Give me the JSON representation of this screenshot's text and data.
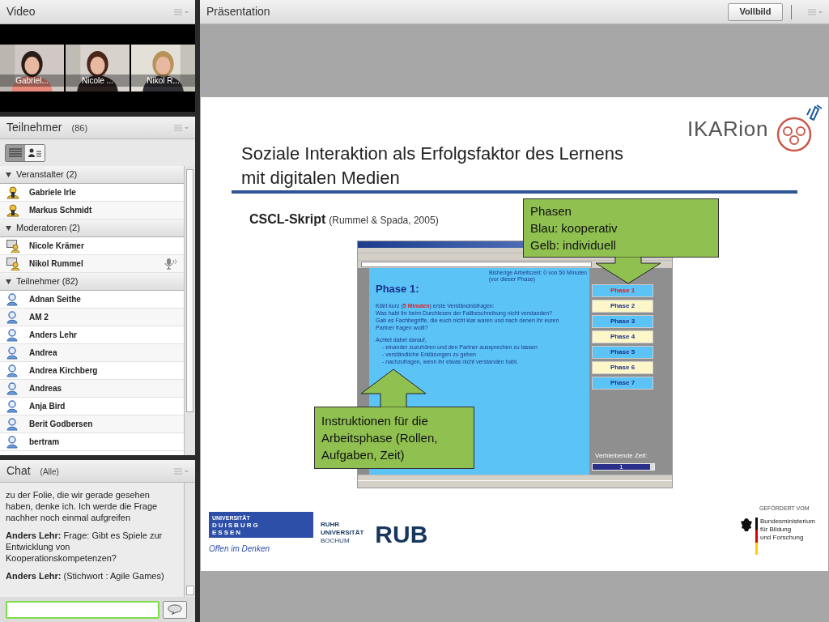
{
  "video": {
    "title": "Video",
    "tiles": [
      {
        "name": "Gabriel..."
      },
      {
        "name": "Nicole ..."
      },
      {
        "name": "Nikol R..."
      }
    ]
  },
  "attendees": {
    "title": "Teilnehmer",
    "count": "(86)",
    "views": [
      {
        "kind": "list",
        "selected": true
      },
      {
        "kind": "card",
        "selected": false
      }
    ],
    "groups": [
      {
        "label": "Veranstalter (2)",
        "expanded": true,
        "members": [
          {
            "name": "Gabriele Irle",
            "kind": "host",
            "speaking": false
          },
          {
            "name": "Markus Schmidt",
            "kind": "host",
            "speaking": false
          }
        ]
      },
      {
        "label": "Moderatoren (2)",
        "expanded": true,
        "members": [
          {
            "name": "Nicole Krämer",
            "kind": "presenter",
            "speaking": false
          },
          {
            "name": "Nikol Rummel",
            "kind": "presenter",
            "speaking": true
          }
        ]
      },
      {
        "label": "Teilnehmer (82)",
        "expanded": true,
        "members": [
          {
            "name": "Adnan Seithe",
            "kind": "participant",
            "speaking": false
          },
          {
            "name": "AM 2",
            "kind": "participant",
            "speaking": false
          },
          {
            "name": "Anders Lehr",
            "kind": "participant",
            "speaking": false
          },
          {
            "name": "Andrea",
            "kind": "participant",
            "speaking": false
          },
          {
            "name": "Andrea Kirchberg",
            "kind": "participant",
            "speaking": false
          },
          {
            "name": "Andreas",
            "kind": "participant",
            "speaking": false
          },
          {
            "name": "Anja Bird",
            "kind": "participant",
            "speaking": false
          },
          {
            "name": "Berit Godbersen",
            "kind": "participant",
            "speaking": false
          },
          {
            "name": "bertram",
            "kind": "participant",
            "speaking": false
          }
        ]
      }
    ]
  },
  "chat": {
    "title": "Chat",
    "scope": "(Alle)",
    "messages": [
      {
        "text": "zu der Folie, die wir gerade gesehen haben, denke ich. Ich werde die Frage nachher noch einmal aufgreifen"
      },
      {
        "author": "Anders Lehr:",
        "text": "Frage: Gibt es Spiele zur Entwicklung von Kooperationskompetenzen?"
      },
      {
        "author": "Anders Lehr:",
        "text": "(Stichwort : Agile Games)"
      }
    ]
  },
  "presentation": {
    "title": "Präsentation",
    "fullscreen_button": "Vollbild",
    "slide": {
      "logo": "IKARion",
      "title_lines": [
        "Soziale Interaktion als Erfolgsfaktor des Lernens",
        "mit digitalen Medien"
      ],
      "subtitle": "CSCL-Skript",
      "citation": "(Rummel & Spada, 2005)",
      "screenshot": {
        "heading": "Phase 1:",
        "status_lines": [
          "Bisherige Arbeitszeit: 0 von 50 Minuten",
          "(vor dieser Phase)"
        ],
        "instructions": [
          "Klärt kurz (**5 Minuten**) erste Verständnisfragen:",
          "Was habt ihr beim Durchlesen der Fallbeschreibung nicht verstanden?",
          "Gab es Fachbegriffe, die euch nicht klar waren und nach denen ihr euren",
          "Partner fragen wollt?"
        ],
        "rules_intro": "Achtet dabei darauf,",
        "rules": [
          "- einander zuzuhören und den Partner aussprechen zu lassen",
          "- verständliche Erklärungen zu geben",
          "- nachzufragen, wenn ihr etwas nicht verstanden habt."
        ],
        "phases": [
          {
            "label": "Phase 1",
            "kind": "cooperative",
            "selected": true
          },
          {
            "label": "Phase 2",
            "kind": "individual",
            "selected": false
          },
          {
            "label": "Phase 3",
            "kind": "cooperative",
            "selected": false
          },
          {
            "label": "Phase 4",
            "kind": "individual",
            "selected": false
          },
          {
            "label": "Phase 5",
            "kind": "cooperative",
            "selected": false
          },
          {
            "label": "Phase 6",
            "kind": "individual",
            "selected": false
          },
          {
            "label": "Phase 7",
            "kind": "cooperative",
            "selected": false
          }
        ],
        "timer_label": "Verbleibende Zeit:",
        "timer_value": "1",
        "level": 0.93
      },
      "callouts": [
        {
          "kind": "down",
          "lines": [
            "Phasen",
            "Blau: kooperativ",
            "Gelb: individuell"
          ]
        },
        {
          "kind": "up",
          "lines": [
            "Instruktionen für die",
            "Arbeitsphase (Rollen,",
            "Aufgaben, Zeit)"
          ]
        }
      ],
      "logos": {
        "ude": [
          "UNIVERSITÄT",
          "DUISBURG",
          "ESSEN"
        ],
        "ude_motto": "Offen im Denken",
        "rub_lines": [
          "RUHR",
          "UNIVERSITÄT",
          "BOCHUM"
        ],
        "rub_mark": "RUB",
        "funder_caption": "GEFÖRDERT VOM",
        "funder_lines": [
          "Bundesministerium",
          "für Bildung",
          "und Forschung"
        ]
      }
    }
  }
}
